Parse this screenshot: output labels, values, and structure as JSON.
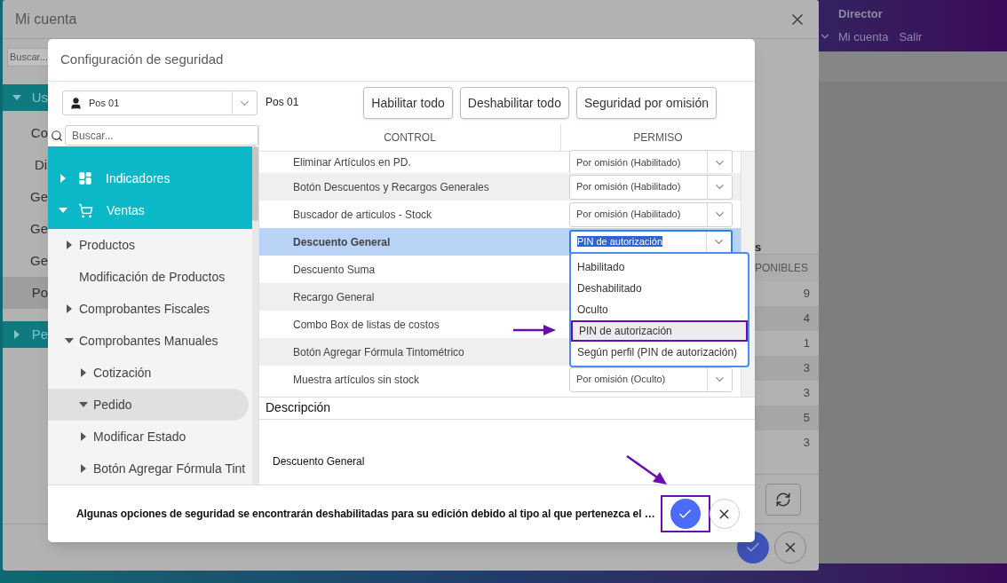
{
  "page_header": {
    "user_role": "Director",
    "links": [
      "Mi cuenta",
      "Salir"
    ]
  },
  "account_dialog": {
    "title": "Mi cuenta",
    "search": {
      "placeholder": "Buscar..."
    },
    "sidebar_items": [
      {
        "label": "Us",
        "kind": "group",
        "expanded": true,
        "selected": false
      },
      {
        "label": "Co",
        "kind": "item",
        "selected": false
      },
      {
        "label": "Di",
        "kind": "item",
        "selected": false
      },
      {
        "label": "Ge",
        "kind": "item",
        "selected": false
      },
      {
        "label": "Ge",
        "kind": "item",
        "selected": false
      },
      {
        "label": "Ge",
        "kind": "item",
        "selected": false
      },
      {
        "label": "Po",
        "kind": "item",
        "selected": true
      },
      {
        "label": "Pe",
        "kind": "group",
        "expanded": false,
        "selected": false
      }
    ],
    "column_fragment": "s",
    "table_header": "PONIBLES",
    "values": [
      "9",
      "4",
      "1",
      "3",
      "3",
      "5",
      "3"
    ]
  },
  "security_dialog": {
    "title": "Configuración de seguridad",
    "profile_select": {
      "value": "Pos 01"
    },
    "profile_label": "Pos 01",
    "buttons": [
      "Habilitar todo",
      "Deshabilitar todo",
      "Seguridad por omisión"
    ],
    "tree_search": {
      "placeholder": "Buscar..."
    },
    "tree": [
      {
        "label": "Indicadores",
        "kind": "dashboard",
        "expanded": false,
        "selected": false
      },
      {
        "label": "Ventas",
        "kind": "cart",
        "expanded": true,
        "selected": false,
        "children": [
          {
            "label": "Productos",
            "expanded": false,
            "selected": false
          },
          {
            "label": "Modificación de Productos",
            "selected": false
          },
          {
            "label": "Comprobantes Fiscales",
            "expanded": false,
            "selected": false
          },
          {
            "label": "Comprobantes Manuales",
            "expanded": true,
            "selected": false,
            "children": [
              {
                "label": "Cotización",
                "expanded": false,
                "selected": false
              },
              {
                "label": "Pedido",
                "expanded": true,
                "selected": true
              },
              {
                "label": "Modificar Estado",
                "expanded": false,
                "selected": false
              },
              {
                "label": "Botón Agregar Fórmula Tint",
                "expanded": false,
                "selected": false
              }
            ]
          }
        ]
      }
    ],
    "table": {
      "columns": [
        "CONTROL",
        "PERMISO"
      ],
      "rows": [
        {
          "control": "Eliminar Artículos en PD.",
          "permission": "Por omisión (Habilitado)",
          "selected": false
        },
        {
          "control": "Botón Descuentos y Recargos Generales",
          "permission": "Por omisión (Habilitado)",
          "selected": false
        },
        {
          "control": "Buscador de articulos - Stock",
          "permission": "Por omisión (Habilitado)",
          "selected": false
        },
        {
          "control": "Descuento General",
          "permission": "PIN de autorización",
          "selected": true
        },
        {
          "control": "Descuento Suma",
          "selected": false
        },
        {
          "control": "Recargo General",
          "selected": false
        },
        {
          "control": "Combo Box de listas de costos",
          "selected": false
        },
        {
          "control": "Botón Agregar Fórmula Tintométrico",
          "selected": false
        },
        {
          "control": "Muestra artículos sin stock",
          "permission": "Por omisión (Oculto)",
          "selected": false
        }
      ]
    },
    "dropdown": {
      "options": [
        {
          "label": "Habilitado",
          "selected": false
        },
        {
          "label": "Deshabilitado",
          "selected": false
        },
        {
          "label": "Oculto",
          "selected": false
        },
        {
          "label": "PIN de autorización",
          "selected": true
        },
        {
          "label": "Según perfil (PIN de autorización)",
          "selected": false
        }
      ]
    },
    "description": {
      "heading": "Descripción",
      "text": "Descuento General"
    },
    "footer": {
      "message": "Algunas opciones de seguridad se encontrarán deshabilitadas para su edición debido al tipo al que pertenezca el …",
      "confirm_highlighted": true
    }
  }
}
